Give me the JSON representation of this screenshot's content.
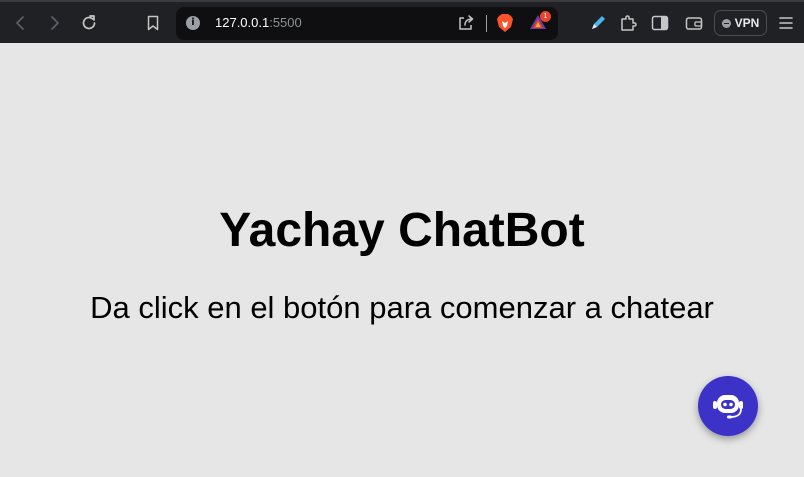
{
  "browser": {
    "url": {
      "host": "127.0.0.1",
      "port": ":5500"
    },
    "rewards_badge": "1",
    "vpn_label": "VPN",
    "icons": {
      "back": "chevron-left-icon",
      "forward": "chevron-right-icon",
      "reload": "reload-icon",
      "bookmark": "bookmark-icon",
      "site_info": "info-icon",
      "share": "share-icon",
      "brave_shields": "brave-lion-icon",
      "rewards": "triangle-rewards-icon",
      "pen": "pen-icon",
      "extensions": "puzzle-icon",
      "sidebar": "sidebar-icon",
      "wallet": "wallet-icon",
      "menu": "hamburger-menu-icon"
    }
  },
  "page": {
    "title": "Yachay ChatBot",
    "subtitle": "Da click en el botón para comenzar a chatear",
    "background": "#e6e6e6",
    "chat_button": {
      "icon": "robot-headset-icon",
      "color": "#3c32c8"
    }
  }
}
